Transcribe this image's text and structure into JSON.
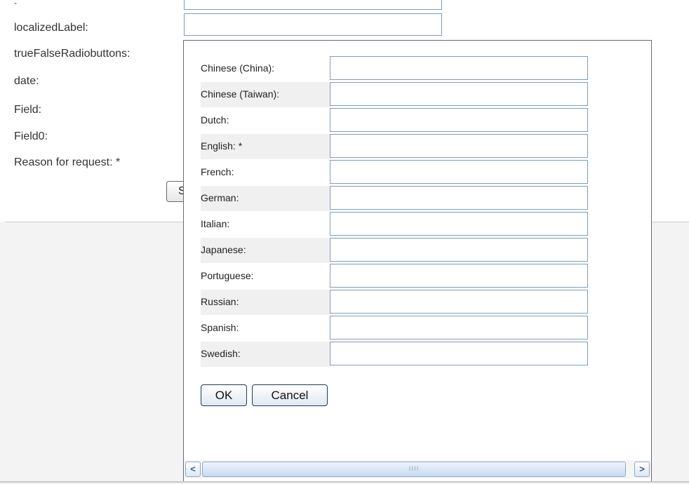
{
  "background_form": {
    "top_dash": "-",
    "fields": [
      {
        "label": "localizedLabel:"
      },
      {
        "label": "trueFalseRadiobuttons:"
      },
      {
        "label": "date:"
      },
      {
        "label": "Field:"
      },
      {
        "label": "Field0:"
      },
      {
        "label": "Reason for request:  *"
      }
    ],
    "partial_button_label": "S"
  },
  "dialog": {
    "languages": [
      {
        "label": "Chinese (China):",
        "value": ""
      },
      {
        "label": "Chinese (Taiwan):",
        "value": ""
      },
      {
        "label": "Dutch:",
        "value": ""
      },
      {
        "label": "English: *",
        "value": ""
      },
      {
        "label": "French:",
        "value": ""
      },
      {
        "label": "German:",
        "value": ""
      },
      {
        "label": "Italian:",
        "value": ""
      },
      {
        "label": "Japanese:",
        "value": ""
      },
      {
        "label": "Portuguese:",
        "value": ""
      },
      {
        "label": "Russian:",
        "value": ""
      },
      {
        "label": "Spanish:",
        "value": ""
      },
      {
        "label": "Swedish:",
        "value": ""
      }
    ],
    "ok_label": "OK",
    "cancel_label": "Cancel",
    "scrollbar": {
      "left_arrow": "<",
      "right_arrow": ">",
      "grip": "IIII"
    }
  },
  "colors": {
    "input_border": "#7f9db9",
    "alt_row": "#f0f0f0",
    "dialog_border": "#6b6b6b",
    "scrollbar_accent": "#8fa8c8"
  }
}
